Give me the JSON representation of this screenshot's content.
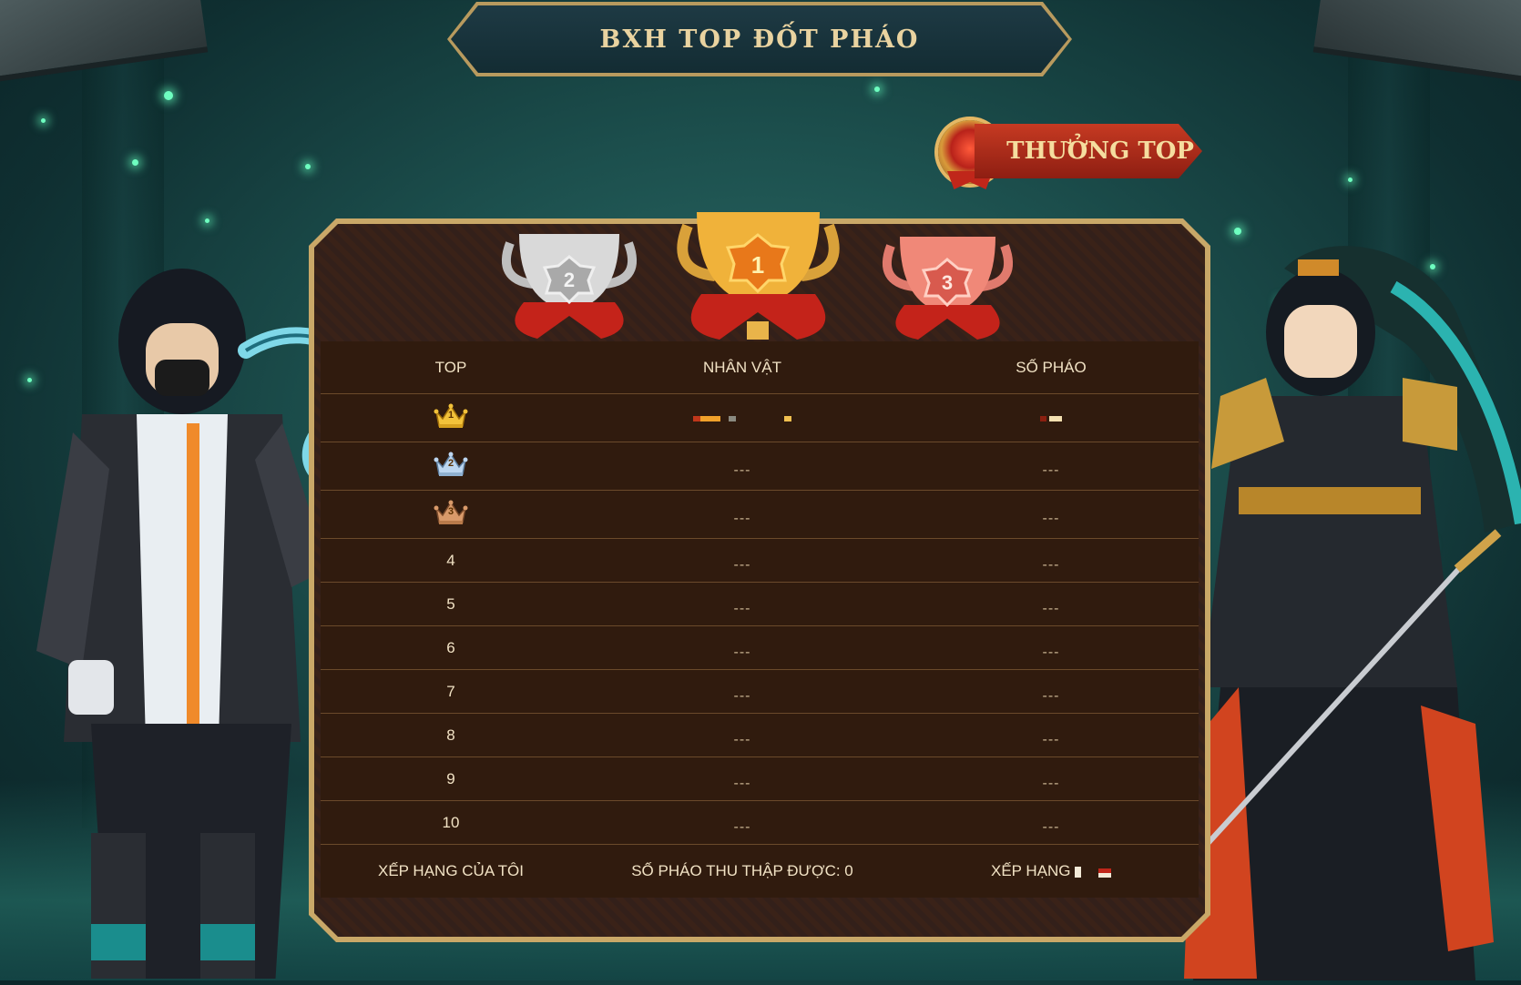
{
  "title": "BXH TOP ĐỐT PHÁO",
  "reward_button": {
    "label": "THƯỞNG TOP"
  },
  "trophies": [
    {
      "rank": "2",
      "color": "#c9c9c9"
    },
    {
      "rank": "1",
      "color": "#f0a62a"
    },
    {
      "rank": "3",
      "color": "#e8776a"
    }
  ],
  "table": {
    "headers": {
      "top": "TOP",
      "character": "NHÂN VẬT",
      "count": "SỐ PHÁO"
    },
    "rows": [
      {
        "rank": "1",
        "character": "",
        "count": ""
      },
      {
        "rank": "2",
        "character": "---",
        "count": "---"
      },
      {
        "rank": "3",
        "character": "---",
        "count": "---"
      },
      {
        "rank": "4",
        "character": "---",
        "count": "---"
      },
      {
        "rank": "5",
        "character": "---",
        "count": "---"
      },
      {
        "rank": "6",
        "character": "---",
        "count": "---"
      },
      {
        "rank": "7",
        "character": "---",
        "count": "---"
      },
      {
        "rank": "8",
        "character": "---",
        "count": "---"
      },
      {
        "rank": "9",
        "character": "---",
        "count": "---"
      },
      {
        "rank": "10",
        "character": "---",
        "count": "---"
      }
    ],
    "footer": {
      "my_rank_label": "XẾP HẠNG CỦA TÔI",
      "collected_label": "SỐ PHÁO THU THẬP ĐƯỢC: 0",
      "rank_label": "XẾP HẠNG"
    }
  },
  "colors": {
    "accent_gold": "#c9a868",
    "table_bg": "#301b0e",
    "reward_red": "#c63a22",
    "bg_teal": "#1c4f4d"
  },
  "icons": [
    "crown-gold-icon",
    "crown-silver-icon",
    "crown-bronze-icon",
    "trophy-icon"
  ]
}
